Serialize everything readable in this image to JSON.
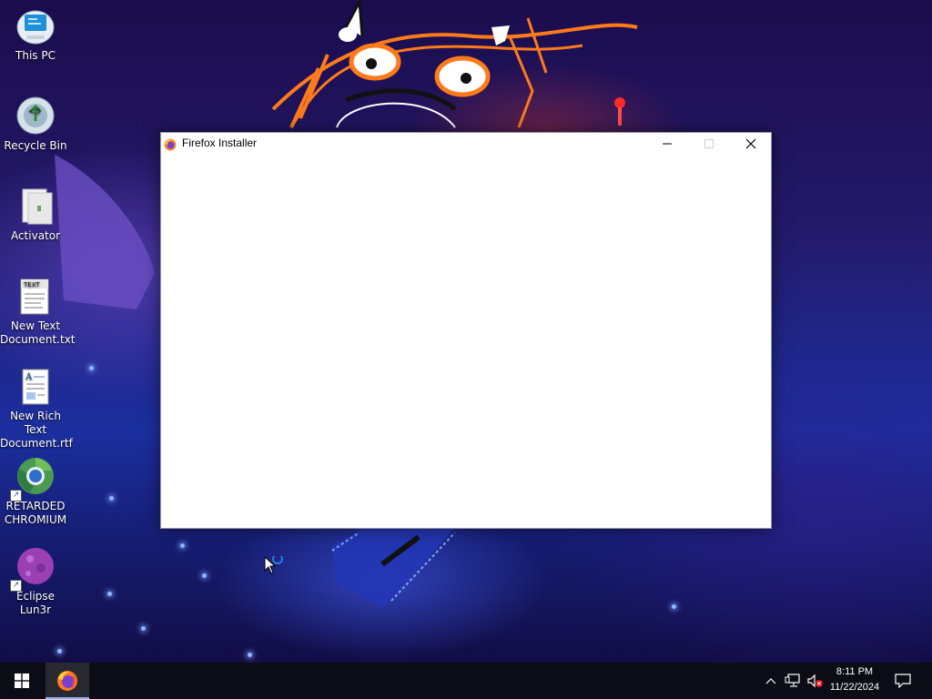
{
  "desktop": {
    "icons": [
      {
        "label": "This PC",
        "icon": "computer-icon"
      },
      {
        "label": "Recycle Bin",
        "icon": "recycle-bin-icon"
      },
      {
        "label": "Activator",
        "icon": "application-icon"
      },
      {
        "label": "New Text Document.txt",
        "icon": "text-document-icon"
      },
      {
        "label": "New Rich Text Document.rtf",
        "icon": "rich-text-document-icon"
      },
      {
        "label": "RETARDED CHROMIUM",
        "icon": "chromium-icon",
        "shortcut": true
      },
      {
        "label": "Eclipse Lun3r",
        "icon": "eclipse-lun3r-icon",
        "shortcut": true
      }
    ]
  },
  "window": {
    "title": "Firefox Installer",
    "icon": "firefox-icon",
    "controls": {
      "minimize": "minimize-icon",
      "maximize": "maximize-icon",
      "close": "close-icon"
    }
  },
  "taskbar": {
    "start": "windows-start-icon",
    "apps": [
      {
        "name": "Firefox Installer",
        "icon": "firefox-icon",
        "active": true
      }
    ],
    "tray": {
      "icons": [
        "chevron-up-icon",
        "network-icon",
        "volume-muted-icon"
      ],
      "time": "8:11 PM",
      "date": "11/22/2024",
      "notification": "action-center-icon"
    }
  },
  "colors": {
    "taskbar": "#0c0c16",
    "accent": "#7fb3ff",
    "window_bg": "#ffffff"
  }
}
